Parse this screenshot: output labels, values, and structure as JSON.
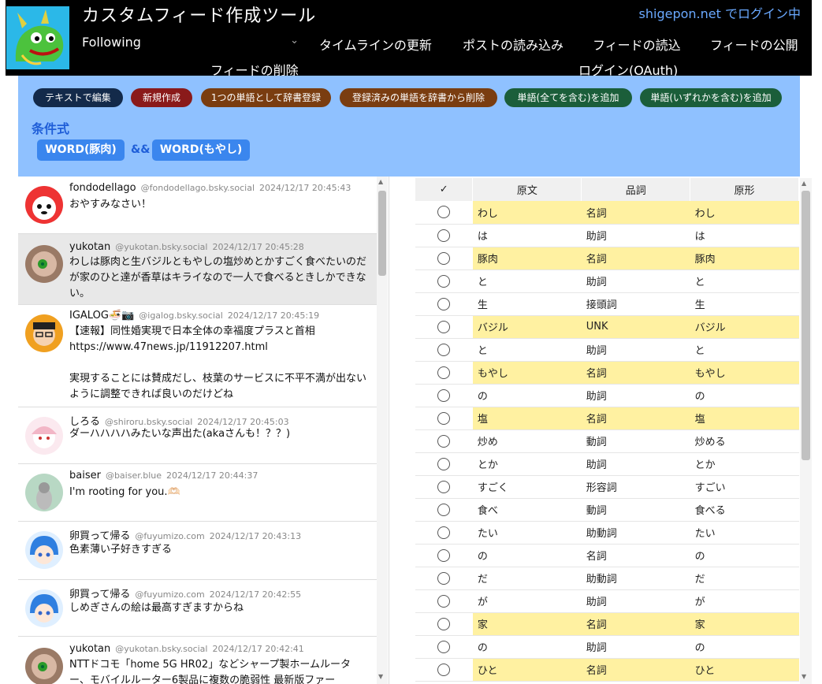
{
  "header": {
    "title": "カスタムフィード作成ツール",
    "login_user": "shigepon.net",
    "login_suffix": " でログイン中",
    "feed_selected": "Following",
    "chevron_glyph": "⌄",
    "nav": {
      "refresh_timeline": "タイムラインの更新",
      "load_posts": "ポストの読み込み",
      "load_feed": "フィードの読込",
      "publish_feed": "フィードの公開",
      "delete_feed": "フィードの削除",
      "login_oauth": "ログイン(OAuth)"
    }
  },
  "toolbar": {
    "edit_as_text": "テキストで編集",
    "new": "新規作成",
    "register_word": "1つの単語として辞書登録",
    "remove_word": "登録済みの単語を辞書から削除",
    "add_all_words": "単語(全てを含む)を追加",
    "add_any_words": "単語(いずれかを含む)を追加",
    "condition_title": "条件式",
    "condition": {
      "left": "WORD(豚肉)",
      "operator": "&&",
      "right": "WORD(もやし)"
    }
  },
  "colors": {
    "header_bg": "#000000",
    "toolbar_bg": "#8fc1ff",
    "pill_navy": "#132a4a",
    "pill_red": "#8a1a1a",
    "pill_brown": "#7a3d10",
    "pill_green": "#1b5e3a",
    "word_chip": "#3a86ee",
    "noun_highlight": "#fff1a1"
  },
  "timeline": {
    "posts": [
      {
        "name": "fondodellago",
        "handle": "@fondodellago.bsky.social",
        "time": "2024/12/17 20:45:43",
        "text": "おやすみなさい！"
      },
      {
        "name": "yukotan",
        "handle": "@yukotan.bsky.social",
        "time": "2024/12/17 20:45:28",
        "text": "わしは豚肉と生バジルともやしの塩炒めとかすごく食べたいのだが家のひと達が香草はキライなので一人で食べるときしかできない。"
      },
      {
        "name": "IGALOG🍜📷",
        "handle": "@igalog.bsky.social",
        "time": "2024/12/17 20:45:19",
        "text": "【速報】同性婚実現で日本全体の幸福度プラスと首相\nhttps://www.47news.jp/11912207.html\n\n実現することには賛成だし、枝葉のサービスに不平不満が出ないように調整できれば良いのだけどね"
      },
      {
        "name": "しろる",
        "handle": "@shiroru.bsky.social",
        "time": "2024/12/17 20:45:03",
        "text": "ダーハハハハみたいな声出た(akaさんも！？？)"
      },
      {
        "name": "baiser",
        "handle": "@baiser.blue",
        "time": "2024/12/17 20:44:37",
        "text": "I'm rooting for you.🫶🏻"
      },
      {
        "name": "卵買って帰る",
        "handle": "@fuyumizo.com",
        "time": "2024/12/17 20:43:13",
        "text": "色素薄い子好きすぎる"
      },
      {
        "name": "卵買って帰る",
        "handle": "@fuyumizo.com",
        "time": "2024/12/17 20:42:55",
        "text": "しめぎさんの絵は最高すぎますからね"
      },
      {
        "name": "yukotan",
        "handle": "@yukotan.bsky.social",
        "time": "2024/12/17 20:42:41",
        "text": "NTTドコモ「home 5G HR02」などシャープ製ホームルーター、モバイルルーター6製品に複数の脆弱性 最新版ファー"
      }
    ]
  },
  "tokens": {
    "columns": [
      "✓",
      "原文",
      "品詞",
      "原形"
    ],
    "rows": [
      {
        "surface": "わし",
        "pos": "名詞",
        "base": "わし",
        "highlight": true
      },
      {
        "surface": "は",
        "pos": "助詞",
        "base": "は",
        "highlight": false
      },
      {
        "surface": "豚肉",
        "pos": "名詞",
        "base": "豚肉",
        "highlight": true
      },
      {
        "surface": "と",
        "pos": "助詞",
        "base": "と",
        "highlight": false
      },
      {
        "surface": "生",
        "pos": "接頭詞",
        "base": "生",
        "highlight": false
      },
      {
        "surface": "バジル",
        "pos": "UNK",
        "base": "バジル",
        "highlight": true
      },
      {
        "surface": "と",
        "pos": "助詞",
        "base": "と",
        "highlight": false
      },
      {
        "surface": "もやし",
        "pos": "名詞",
        "base": "もやし",
        "highlight": true
      },
      {
        "surface": "の",
        "pos": "助詞",
        "base": "の",
        "highlight": false
      },
      {
        "surface": "塩",
        "pos": "名詞",
        "base": "塩",
        "highlight": true
      },
      {
        "surface": "炒め",
        "pos": "動詞",
        "base": "炒める",
        "highlight": false
      },
      {
        "surface": "とか",
        "pos": "助詞",
        "base": "とか",
        "highlight": false
      },
      {
        "surface": "すごく",
        "pos": "形容詞",
        "base": "すごい",
        "highlight": false
      },
      {
        "surface": "食べ",
        "pos": "動詞",
        "base": "食べる",
        "highlight": false
      },
      {
        "surface": "たい",
        "pos": "助動詞",
        "base": "たい",
        "highlight": false
      },
      {
        "surface": "の",
        "pos": "名詞",
        "base": "の",
        "highlight": false
      },
      {
        "surface": "だ",
        "pos": "助動詞",
        "base": "だ",
        "highlight": false
      },
      {
        "surface": "が",
        "pos": "助詞",
        "base": "が",
        "highlight": false
      },
      {
        "surface": "家",
        "pos": "名詞",
        "base": "家",
        "highlight": true
      },
      {
        "surface": "の",
        "pos": "助詞",
        "base": "の",
        "highlight": false
      },
      {
        "surface": "ひと",
        "pos": "名詞",
        "base": "ひと",
        "highlight": true
      }
    ]
  }
}
